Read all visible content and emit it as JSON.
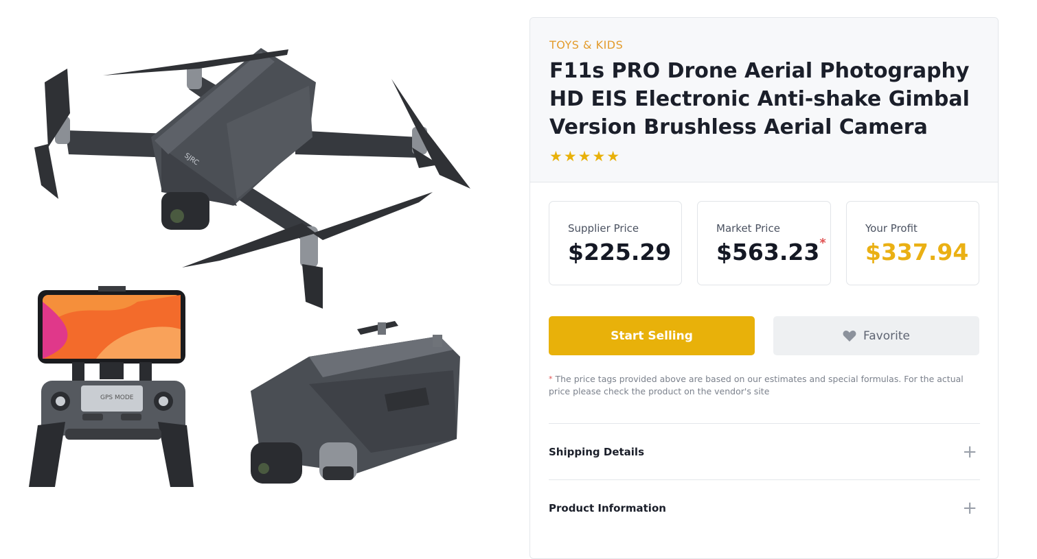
{
  "product": {
    "category": "TOYS & KIDS",
    "title": "F11s PRO Drone Aerial Photography HD EIS Electronic Anti-shake Gimbal Version Brushless Aerial Camera",
    "rating_stars": "★★★★★",
    "rating": 5
  },
  "prices": {
    "supplier_label": "Supplier Price",
    "supplier_value": "$225.29",
    "market_label": "Market Price",
    "market_value": "$563.23",
    "market_asterisk": "*",
    "profit_label": "Your Profit",
    "profit_value": "$337.94"
  },
  "actions": {
    "start_selling": "Start Selling",
    "favorite": "Favorite"
  },
  "disclaimer": {
    "asterisk": "*",
    "text": "The price tags provided above are based on our estimates and special formulas. For the actual price please check the product on the vendor's site"
  },
  "accordion": [
    {
      "label": "Shipping Details",
      "icon": "+"
    },
    {
      "label": "Product Information",
      "icon": "+"
    }
  ],
  "images": {
    "drone_label": "SJRC",
    "remote_label": "GPS MODE"
  },
  "colors": {
    "accent": "#e8b10a",
    "category": "#e39b2b",
    "asterisk": "#e05252"
  }
}
